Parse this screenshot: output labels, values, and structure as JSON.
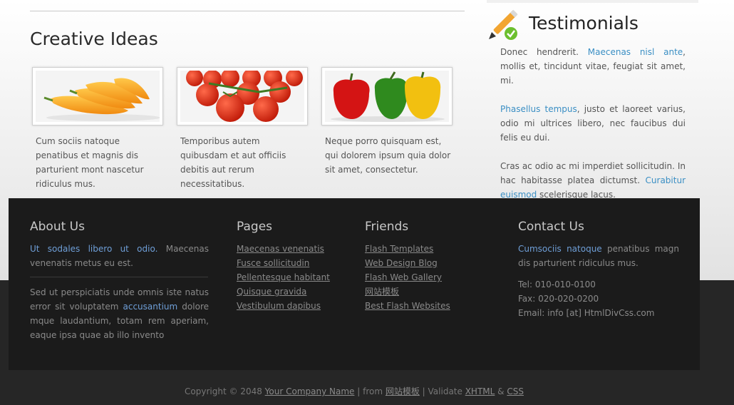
{
  "creative": {
    "title": "Creative Ideas",
    "items": [
      {
        "image": "orange-peppers-photo",
        "caption": "Cum sociis natoque penatibus et magnis dis parturient mont nascetur ridiculus mus."
      },
      {
        "image": "tomatoes-photo",
        "caption": "Temporibus autem quibusdam et aut officiis debitis aut rerum necessitatibus."
      },
      {
        "image": "bell-peppers-photo",
        "caption": "Neque porro quisquam est, qui dolorem ipsum quia dolor sit amet, consectetur."
      }
    ]
  },
  "testimonials": {
    "title": "Testimonials",
    "p1_a": "Donec hendrerit. ",
    "p1_link": "Maecenas nisl ante",
    "p1_b": ", mollis et, tincidunt vitae, feugiat sit amet, mi.",
    "p2_link": "Phasellus tempus",
    "p2_b": ", justo et laoreet varius, odio mi ultrices libero, nec faucibus dui felis eu dui.",
    "p3_a": "Cras ac odio ac mi imperdiet sollicitudin. In hac habitasse platea dictumst. ",
    "p3_link": "Curabitur euismod",
    "p3_b": " scelerisque lacus."
  },
  "footer": {
    "about": {
      "title": "About Us",
      "p1_link": "Ut sodales libero ut odio.",
      "p1_b": " Maecenas venenatis metus eu est.",
      "p2_a": "Sed ut perspiciatis unde omnis iste natus error sit voluptatem ",
      "p2_link": "accusantium",
      "p2_b": " dolore mque laudantium, totam rem aperiam, eaque ipsa quae ab illo invento"
    },
    "pages": {
      "title": "Pages",
      "links": [
        "Maecenas venenatis",
        "Fusce sollicitudin",
        "Pellentesque habitant",
        "Quisque gravida",
        "Vestibulum dapibus"
      ]
    },
    "friends": {
      "title": "Friends",
      "links": [
        "Flash Templates",
        "Web Design Blog",
        "Flash Web Gallery",
        "网站模板",
        "Best Flash Websites"
      ]
    },
    "contact": {
      "title": "Contact Us",
      "p_link": "Cumsociis natoque",
      "p_b": " penatibus magn dis parturient ridiculus mus.",
      "tel": "Tel: 010-010-0100",
      "fax": "Fax: 020-020-0200",
      "email": "Email: info [at] HtmlDivCss.com"
    }
  },
  "copyright": {
    "prefix": "Copyright © 2048 ",
    "company": "Your Company Name",
    "from": " | from ",
    "site": "网站模板",
    "validate": " | Validate ",
    "xhtml": "XHTML",
    "amp": " & ",
    "css": "CSS"
  }
}
